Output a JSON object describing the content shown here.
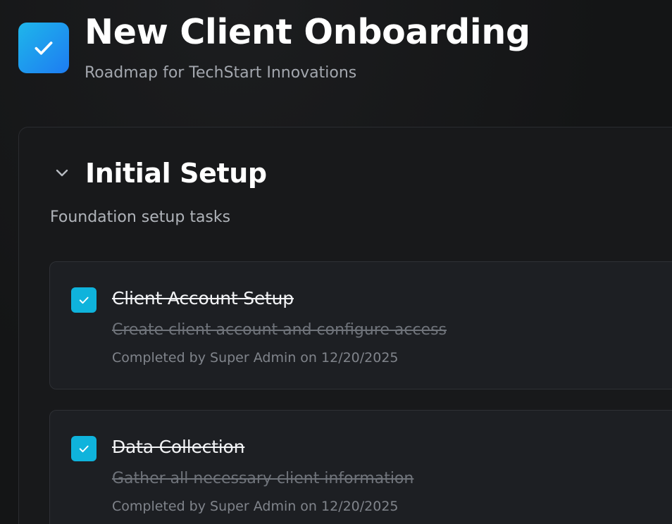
{
  "header": {
    "title": "New Client Onboarding",
    "subtitle": "Roadmap for TechStart Innovations",
    "icon": "checkmark-icon"
  },
  "section": {
    "title": "Initial Setup",
    "description": "Foundation setup tasks",
    "expanded": true,
    "toggle_icon": "chevron-down-icon",
    "tasks": [
      {
        "title": "Client Account Setup",
        "description": "Create client account and configure access",
        "completed_text": "Completed by Super Admin on 12/20/2025",
        "completed": true
      },
      {
        "title": "Data Collection",
        "description": "Gather all necessary client information",
        "completed_text": "Completed by Super Admin on 12/20/2025",
        "completed": true
      }
    ]
  },
  "colors": {
    "background": "#141516",
    "accent": "#0fb3dc",
    "icon_gradient_start": "#1fb6ea",
    "icon_gradient_end": "#1d7cf2"
  }
}
